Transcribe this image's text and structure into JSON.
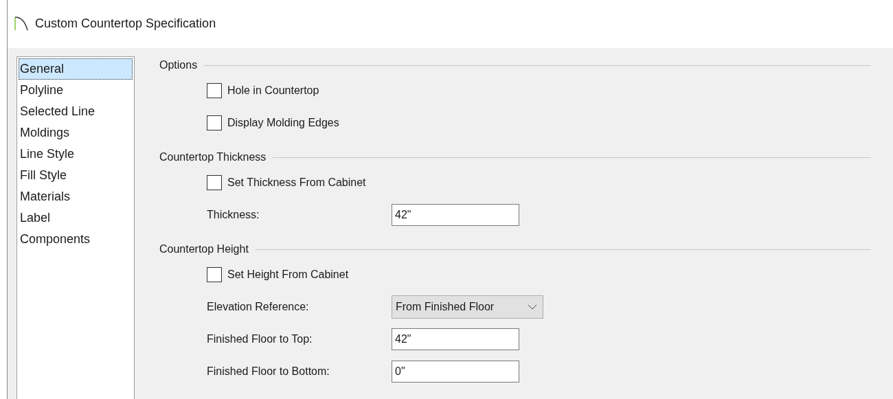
{
  "window": {
    "title": "Custom Countertop Specification"
  },
  "sidebar": {
    "items": [
      {
        "label": "General",
        "selected": true
      },
      {
        "label": "Polyline",
        "selected": false
      },
      {
        "label": "Selected Line",
        "selected": false
      },
      {
        "label": "Moldings",
        "selected": false
      },
      {
        "label": "Line Style",
        "selected": false
      },
      {
        "label": "Fill Style",
        "selected": false
      },
      {
        "label": "Materials",
        "selected": false
      },
      {
        "label": "Label",
        "selected": false
      },
      {
        "label": "Components",
        "selected": false
      }
    ]
  },
  "sections": [
    {
      "title": "Options",
      "items": [
        {
          "kind": "checkbox",
          "label": "Hole in Countertop",
          "checked": false
        },
        {
          "kind": "checkbox",
          "label": "Display Molding Edges",
          "checked": false
        }
      ]
    },
    {
      "title": "Countertop Thickness",
      "items": [
        {
          "kind": "checkbox",
          "label": "Set Thickness From Cabinet",
          "checked": false
        },
        {
          "kind": "field",
          "label": "Thickness:",
          "value": "42\""
        }
      ]
    },
    {
      "title": "Countertop Height",
      "items": [
        {
          "kind": "checkbox",
          "label": "Set Height From Cabinet",
          "checked": false
        },
        {
          "kind": "dropdown",
          "label": "Elevation Reference:",
          "value": "From Finished Floor"
        },
        {
          "kind": "field",
          "label": "Finished Floor to Top:",
          "value": "42\""
        },
        {
          "kind": "field",
          "label": "Finished Floor to Bottom:",
          "value": "0\""
        }
      ]
    }
  ]
}
